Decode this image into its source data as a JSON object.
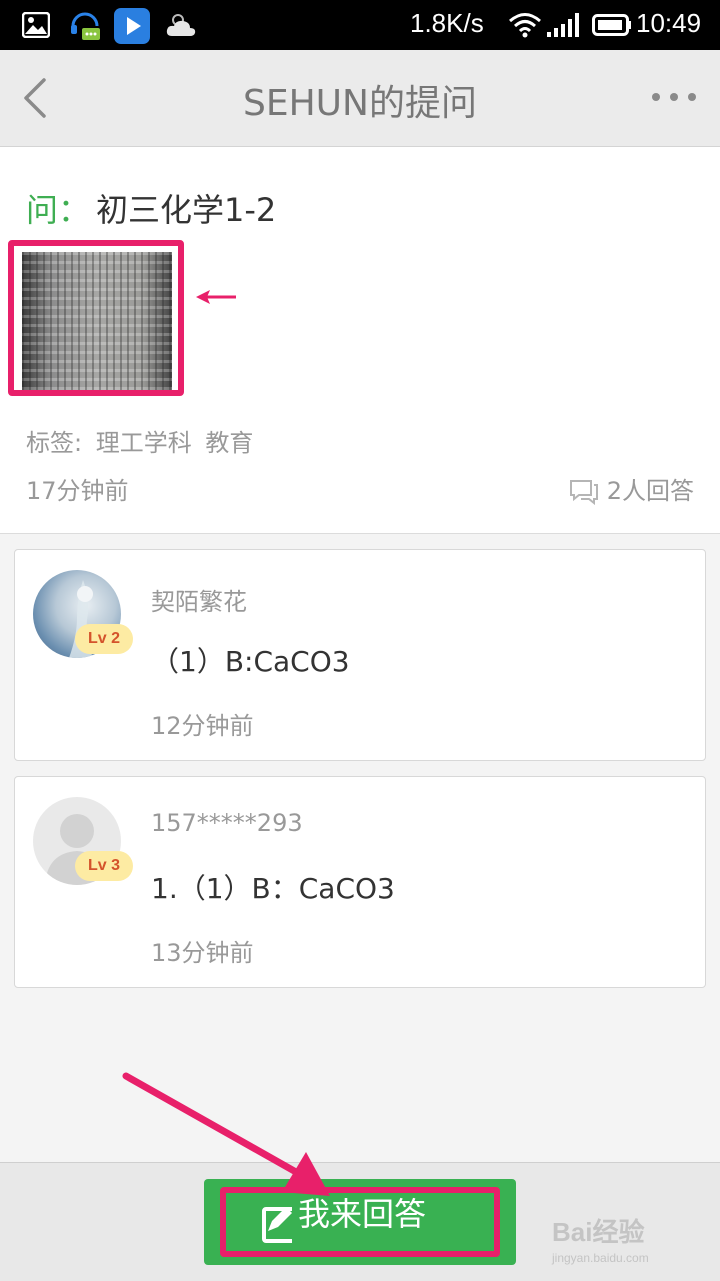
{
  "status_bar": {
    "net_speed": "1.8K/s",
    "time": "10:49",
    "icons": [
      "gallery-icon",
      "chat-headset-icon",
      "play-store-icon",
      "weather-cloud-icon",
      "wifi-icon",
      "signal-icon",
      "battery-icon"
    ]
  },
  "nav": {
    "title": "SEHUN的提问",
    "back_icon": "back-chevron-icon",
    "more_icon": "more-dots-icon"
  },
  "question": {
    "prefix": "问：",
    "title": "初三化学1-2",
    "tags_label": "标签:",
    "tags": [
      "理工学科",
      "教育"
    ],
    "time": "17分钟前",
    "answers_count": "2人回答"
  },
  "answers": [
    {
      "name": "契陌繁花",
      "level": "Lv 2",
      "text": "（1）B:CaCO3",
      "time": "12分钟前"
    },
    {
      "name": "157*****293",
      "level": "Lv 3",
      "text": "1.（1）B：CaCO3",
      "time": "13分钟前"
    }
  ],
  "bottom": {
    "answer_button": "我来回答"
  },
  "watermark": {
    "brand": "Bai经验",
    "url": "jingyan.baidu.com"
  },
  "colors": {
    "accent_green": "#39b152",
    "highlight_pink": "#e8206a",
    "level_badge_bg": "#fdeba3"
  }
}
